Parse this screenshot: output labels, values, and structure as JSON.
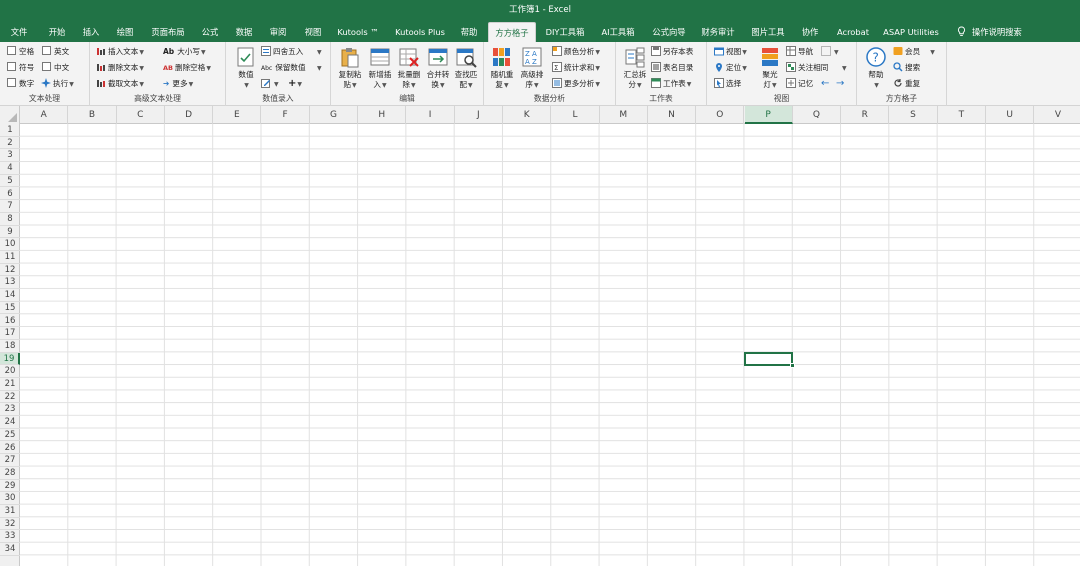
{
  "window": {
    "title": "工作簿1  -  Excel"
  },
  "menu": {
    "tabs": [
      "文件",
      "开始",
      "插入",
      "绘图",
      "页面布局",
      "公式",
      "数据",
      "审阅",
      "视图",
      "Kutools ™",
      "Kutools Plus",
      "帮助",
      "方方格子",
      "DIY工具箱",
      "AI工具箱",
      "公式向导",
      "财务审计",
      "图片工具",
      "协作",
      "Acrobat",
      "ASAP Utilities"
    ],
    "active_tab": "方方格子",
    "search_label": "操作说明搜索"
  },
  "ribbon": {
    "text_group": {
      "label": "文本处理",
      "space": "空格",
      "english": "英文",
      "symbol": "符号",
      "chinese": "中文",
      "number": "数字",
      "execute": "执行"
    },
    "adv_text_group": {
      "label": "高级文本处理",
      "insert_text": "插入文本",
      "delete_text": "删除文本",
      "extract_text": "截取文本",
      "case": "大小写",
      "delete_space": "删除空格",
      "more": "更多"
    },
    "input_group": {
      "label": "数值录入",
      "values": "数值",
      "round": "四舍五入",
      "keep_value": "保留数值"
    },
    "edit_group": {
      "label": "编辑",
      "copy_paste": [
        "复制粘",
        "贴"
      ],
      "add_insert": [
        "新增插",
        "入"
      ],
      "batch_delete": [
        "批量删",
        "除"
      ],
      "merge_convert": [
        "合并转",
        "换"
      ],
      "find_match": [
        "查找匹",
        "配"
      ]
    },
    "analysis_group": {
      "label": "数据分析",
      "random_repeat": [
        "随机重",
        "复"
      ],
      "adv_sort": [
        "高级排",
        "序"
      ],
      "color_analysis": "颜色分析",
      "stat_sum": "统计求和",
      "more_analysis": "更多分析"
    },
    "sheet_group": {
      "label": "工作表",
      "summary_split": [
        "汇总拆",
        "分"
      ],
      "save_sheet": "另存本表",
      "sheet_dir": "表名目录",
      "sheet": "工作表"
    },
    "view_group": {
      "label": "视图",
      "view": "视图",
      "locate": "定位",
      "select": "选择",
      "spotlight": [
        "聚光",
        "灯"
      ],
      "navigate": "导航",
      "focus": "关注相同",
      "remember": "记忆"
    },
    "ffgz_group": {
      "label": "方方格子",
      "help": "帮助",
      "member": "会员",
      "search": "搜索",
      "repeat": "重复"
    }
  },
  "sheet": {
    "columns": [
      "A",
      "B",
      "C",
      "D",
      "E",
      "F",
      "G",
      "H",
      "I",
      "J",
      "K",
      "L",
      "M",
      "N",
      "O",
      "P",
      "Q",
      "R",
      "S",
      "T",
      "U",
      "V"
    ],
    "rows": [
      "1",
      "2",
      "3",
      "4",
      "5",
      "6",
      "7",
      "8",
      "9",
      "10",
      "11",
      "12",
      "13",
      "14",
      "15",
      "16",
      "17",
      "18",
      "19",
      "20",
      "21",
      "22",
      "23",
      "24",
      "25",
      "26",
      "27",
      "28",
      "29",
      "30",
      "31",
      "32",
      "33",
      "34"
    ],
    "active_col": "P",
    "active_row": "19"
  },
  "colors": {
    "excel_green": "#217346",
    "ribbon_bg": "#f3f3f3",
    "header_bg": "#f0f0f0",
    "grid_line": "#e1e1e1"
  }
}
